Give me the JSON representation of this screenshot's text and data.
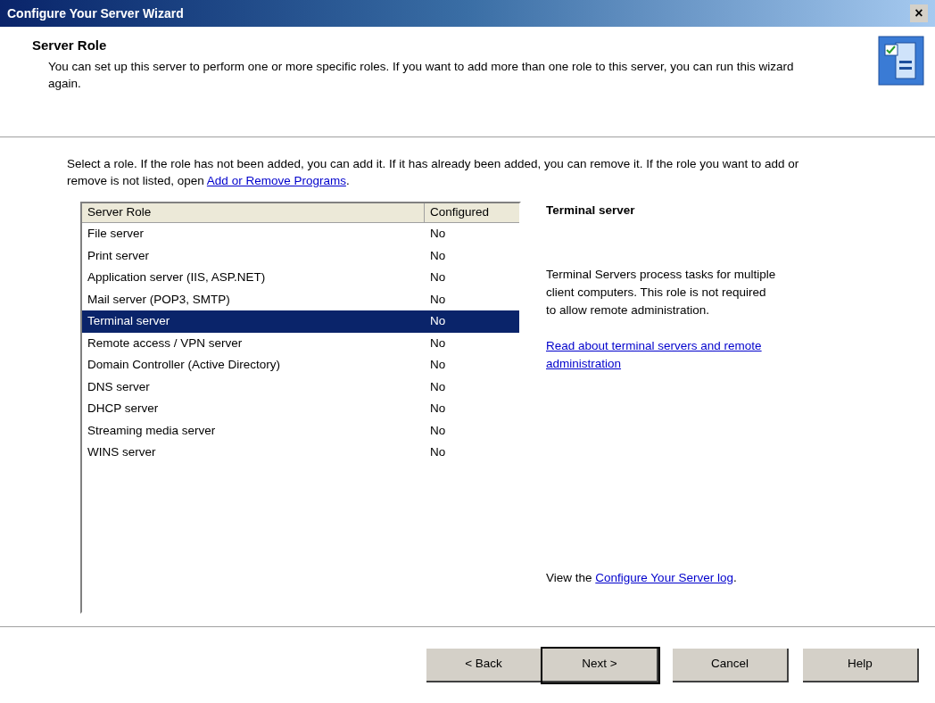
{
  "window": {
    "title": "Configure Your Server Wizard",
    "close": "×"
  },
  "header": {
    "title": "Server Role",
    "description": "You can set up this server to perform one or more specific roles. If you want to add more than one role to this server, you can run this wizard again."
  },
  "instructions": {
    "text": "Select a role. If the role has not been added, you can add it. If it has already been added, you can remove it. If the role you want to add or remove is not listed, open",
    "link": "Add or Remove Programs",
    "end": "."
  },
  "table": {
    "columns": [
      "Server Role",
      "Configured"
    ],
    "rows": [
      {
        "role": "File server",
        "configured": "No",
        "selected": false
      },
      {
        "role": "Print server",
        "configured": "No",
        "selected": false
      },
      {
        "role": "Application server (IIS, ASP.NET)",
        "configured": "No",
        "selected": false
      },
      {
        "role": "Mail server (POP3, SMTP)",
        "configured": "No",
        "selected": false
      },
      {
        "role": "Terminal server",
        "configured": "No",
        "selected": true
      },
      {
        "role": "Remote access / VPN server",
        "configured": "No",
        "selected": false
      },
      {
        "role": "Domain Controller (Active Directory)",
        "configured": "No",
        "selected": false
      },
      {
        "role": "DNS server",
        "configured": "No",
        "selected": false
      },
      {
        "role": "DHCP server",
        "configured": "No",
        "selected": false
      },
      {
        "role": "Streaming media server",
        "configured": "No",
        "selected": false
      },
      {
        "role": "WINS server",
        "configured": "No",
        "selected": false
      }
    ]
  },
  "details": {
    "title": "Terminal server",
    "description": "Terminal Servers process tasks for multiple client computers. This role is not required to allow remote administration.",
    "link": "Read about terminal servers and remote administration",
    "log_prefix": "View the",
    "log_link": "Configure Your Server log",
    "log_end": "."
  },
  "buttons": [
    {
      "label": "< Back",
      "default": false
    },
    {
      "label": "Next >",
      "default": true
    },
    {
      "label": "Cancel",
      "default": false
    },
    {
      "label": "Help",
      "default": false
    }
  ]
}
